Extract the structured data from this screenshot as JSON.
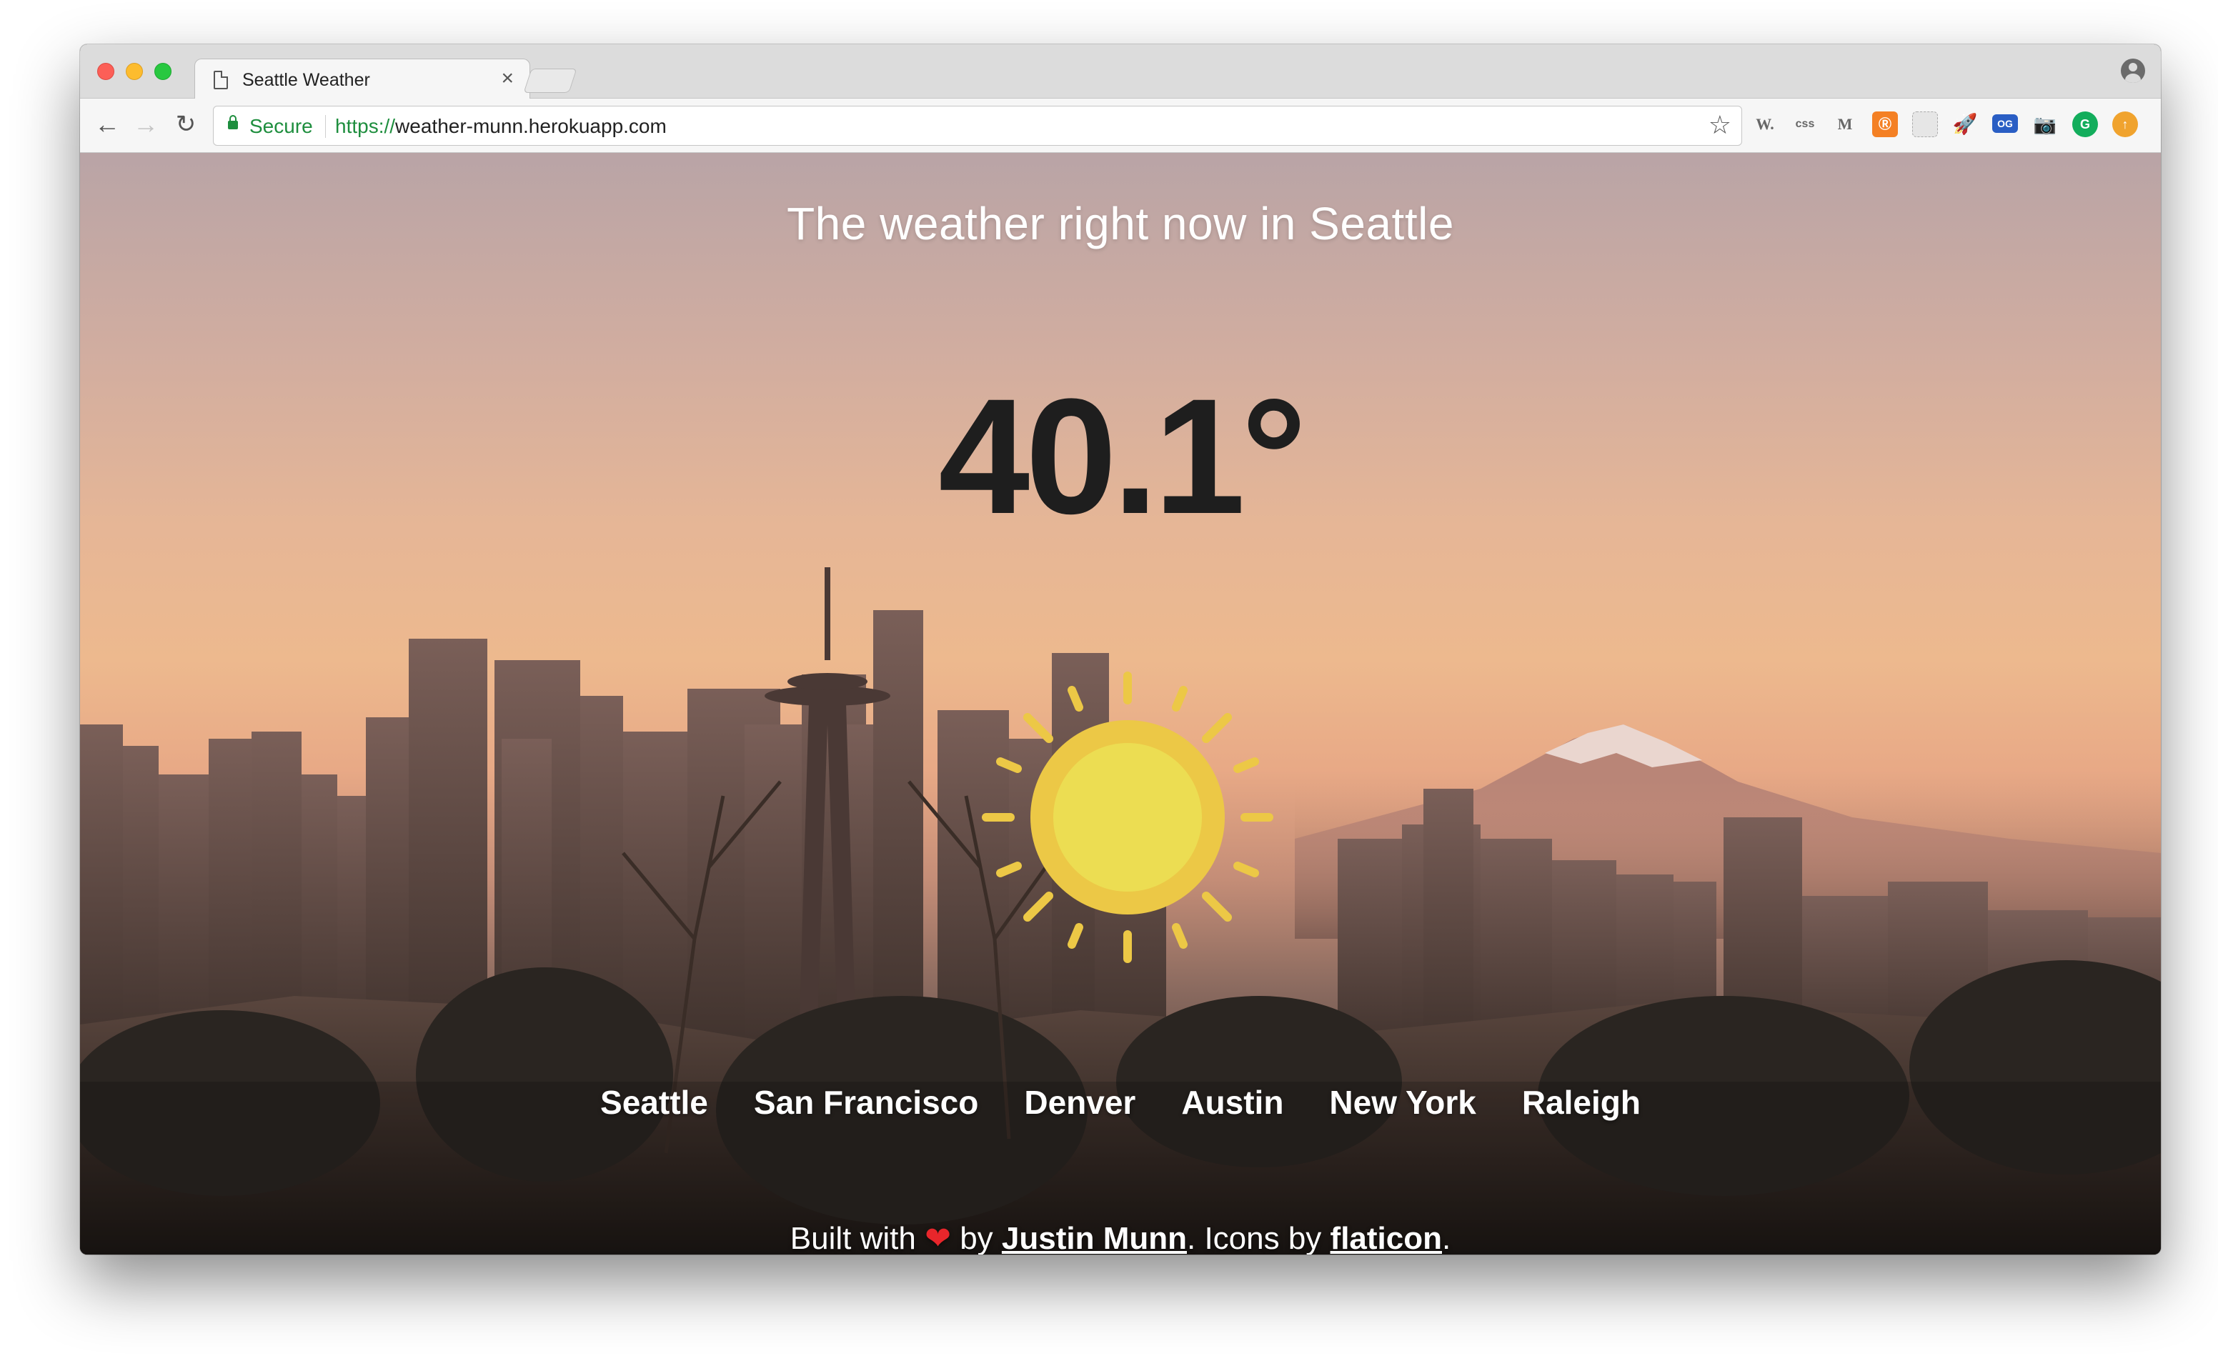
{
  "browser": {
    "tab_title": "Seattle Weather",
    "tab_close": "×",
    "secure_label": "Secure",
    "url_scheme": "https://",
    "url_host": "weather-munn.herokuapp.com",
    "extensions": [
      "W.",
      "css",
      "M",
      "Ⓡ",
      "",
      "🚀",
      "OG",
      "📷",
      "G",
      "↑"
    ]
  },
  "page": {
    "headline": "The weather right now in Seattle",
    "temperature": "40.1°",
    "condition_icon": "sun-icon",
    "cities": [
      "Seattle",
      "San Francisco",
      "Denver",
      "Austin",
      "New York",
      "Raleigh"
    ],
    "footer": {
      "built_with": "Built with",
      "heart": "❤",
      "by": "by",
      "author": "Justin Munn",
      "icons_by": ". Icons by",
      "icon_source": "flaticon",
      "end": "."
    }
  },
  "colors": {
    "sun_core": "#ecdd52",
    "sun_ring": "#ecc846",
    "secure_green": "#1e8e3e"
  }
}
